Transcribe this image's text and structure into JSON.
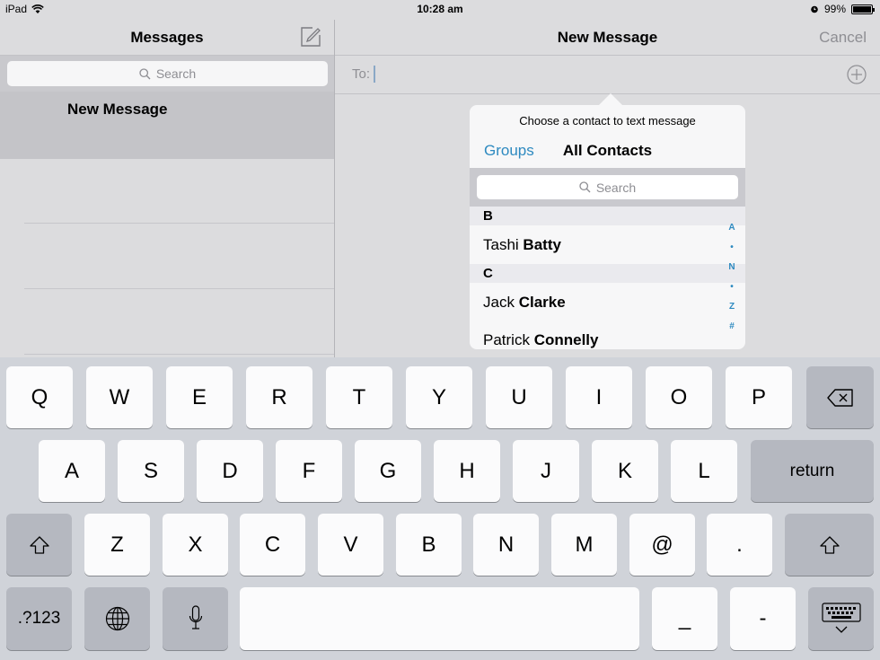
{
  "status_bar": {
    "device": "iPad",
    "time": "10:28 am",
    "battery": "99%"
  },
  "left_pane": {
    "title": "Messages",
    "search_placeholder": "Search",
    "conversations": [
      "New Message"
    ]
  },
  "right_pane": {
    "title": "New Message",
    "cancel": "Cancel",
    "to_label": "To:"
  },
  "popover": {
    "title": "Choose a contact to text message",
    "groups": "Groups",
    "all_contacts": "All Contacts",
    "search_placeholder": "Search",
    "sections": [
      {
        "letter": "B",
        "contacts": [
          {
            "first": "Tashi",
            "last": "Batty"
          }
        ]
      },
      {
        "letter": "C",
        "contacts": [
          {
            "first": "Jack",
            "last": "Clarke"
          },
          {
            "first": "Patrick",
            "last": "Connelly"
          }
        ]
      }
    ],
    "index": [
      "A",
      "•",
      "N",
      "•",
      "Z",
      "#"
    ]
  },
  "keyboard": {
    "row1": [
      "Q",
      "W",
      "E",
      "R",
      "T",
      "Y",
      "U",
      "I",
      "O",
      "P"
    ],
    "row2": [
      "A",
      "S",
      "D",
      "F",
      "G",
      "H",
      "J",
      "K",
      "L"
    ],
    "row3": [
      "Z",
      "X",
      "C",
      "V",
      "B",
      "N",
      "M",
      "@",
      "."
    ],
    "return": "return",
    "numbers": ".?123",
    "underscore": "_",
    "dash": "-"
  }
}
